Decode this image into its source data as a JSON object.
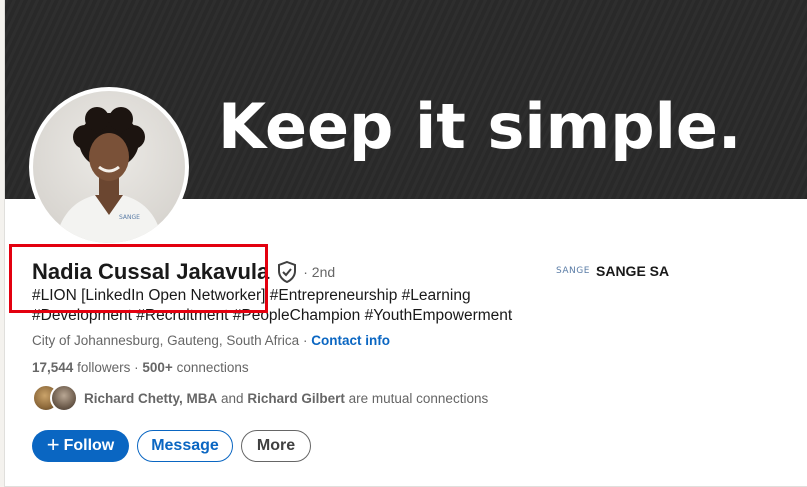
{
  "profile": {
    "banner_text": "Keep it simple.",
    "name": "Nadia Cussal Jakavula",
    "degree": "· 2nd",
    "headline": "#LION [LinkedIn Open Networker] #Entrepreneurship #Learning #Development #Recruitment #PeopleChampion #YouthEmpowerment",
    "location": "City of Johannesburg, Gauteng, South Africa",
    "separator": "·",
    "contact_label": "Contact info",
    "followers_count": "17,544",
    "followers_label": "followers",
    "connections_separator": "·",
    "connections_count": "500+",
    "connections_label": "connections",
    "mutual_name_1": "Richard Chetty, MBA",
    "mutual_and": "and",
    "mutual_name_2": "Richard Gilbert",
    "mutual_suffix": "are mutual connections",
    "company_logo_text": "SANGE",
    "company_name": "SANGE SA"
  },
  "actions": {
    "follow_label": "Follow",
    "follow_icon": "+",
    "message_label": "Message",
    "more_label": "More"
  },
  "colors": {
    "primary": "#0a66c2",
    "highlight": "#e3000f",
    "banner_bg": "#2a2a2a"
  }
}
